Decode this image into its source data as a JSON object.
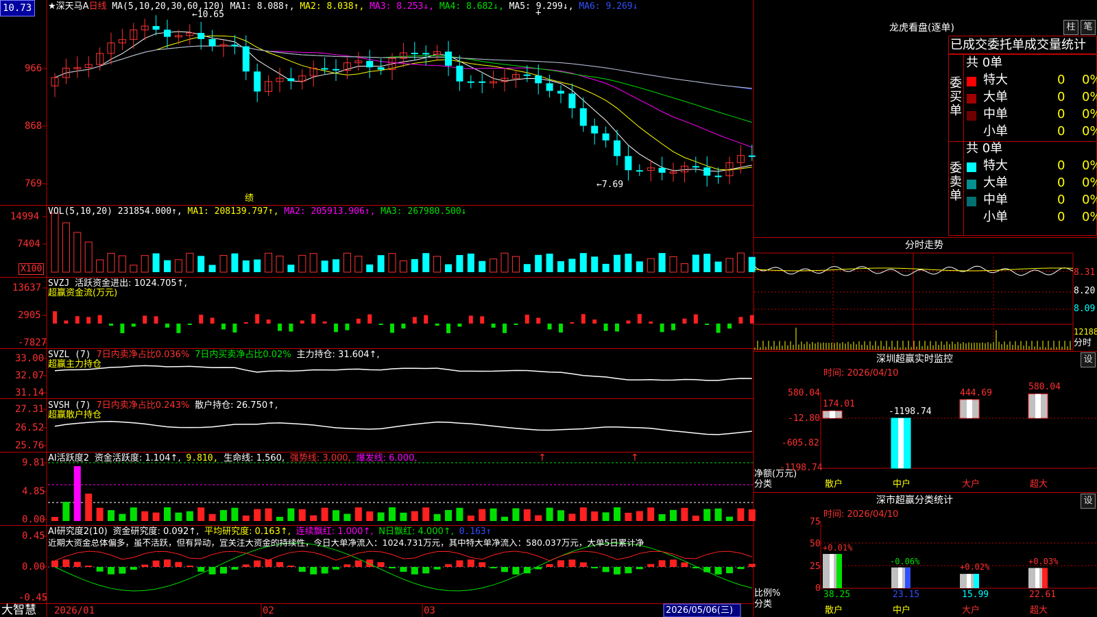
{
  "chart_title": "深天马A",
  "star": "★",
  "period": "日线",
  "price_tag": "10.73",
  "brand": "大智慧",
  "main": {
    "ma_header": "MA(5,10,20,30,60,120)",
    "ma1": "MA1: 8.088↑,",
    "ma2": "MA2: 8.038↑,",
    "ma3": "MA3: 8.253↓,",
    "ma4": "MA4: 8.682↓,",
    "ma5": "MA5: 9.299↓,",
    "ma6": "MA6: 9.269↓",
    "y_ticks": [
      "966",
      "868",
      "769"
    ],
    "high_note": "←10.65",
    "low_note": "←7.69",
    "earnings_marker": "绩",
    "plus_mark": "+"
  },
  "vol": {
    "header": "VOL(5,10,20)",
    "value": "231854.000↑,",
    "ma1": "MA1: 208139.797↑,",
    "ma2": "MA2: 205913.906↑,",
    "ma3": "MA3: 267980.500↓",
    "y_ticks": [
      "14994",
      "7404"
    ],
    "unit": "X100"
  },
  "svzj": {
    "name": "SVZJ",
    "label": "活跃资金进出: 1024.705↑,",
    "subtitle": "超赢资金流(万元)",
    "y_ticks": [
      "13637",
      "2905",
      "-7827"
    ]
  },
  "svzl": {
    "name": "SVZL (7)",
    "a": "7日内卖净占比0.036%",
    "b": "7日内买卖净占比0.02%",
    "c": "主力持仓: 31.604↑,",
    "subtitle": "超赢主力持仓",
    "y_ticks": [
      "33.00",
      "32.07",
      "31.14"
    ]
  },
  "svsh": {
    "name": "SVSH (7)",
    "a": "7日内卖净占比0.243%",
    "b": "散户持仓: 26.750↑,",
    "subtitle": "超赢散户持仓",
    "y_ticks": [
      "27.31",
      "26.52",
      "25.76"
    ]
  },
  "ai_active": {
    "name": "AI活跃度2",
    "a": "资金活跃度: 1.104↑,",
    "b": "9.810,",
    "c": "生命线: 1.560,",
    "d": "强势线: 3.000,",
    "e": "爆发线: 6.000,",
    "y_ticks": [
      "9.81",
      "4.85",
      "0.00"
    ]
  },
  "ai_research": {
    "name": "AI研究度2(10)",
    "a": "资金研究度: 0.092↑,",
    "b": "平均研究度: 0.163↑,",
    "c": "连续飘红: 1.000↑,",
    "d": "N日飘红: 4.000↑,",
    "e": "0.163↑",
    "comment": "近期大资金总体偏多，虽不活跃，但有异动，宜关注大资金的持续性，今日大单净流入：1024.731万元，其中特大单净流入：580.037万元，大单5日累计净",
    "y_ticks": [
      "0.45",
      "0.00",
      "-0.45"
    ]
  },
  "date_axis": {
    "labels": [
      "2026/01",
      "02",
      "03"
    ],
    "current": "2026/05/06(三)"
  },
  "dragon": {
    "title": "龙虎看盘(逐单)",
    "btn1": "柱",
    "btn2": "笔",
    "tabs": "已成交委托单成交量统计",
    "buy_label": "委买单",
    "sell_label": "委卖单",
    "buy_total": "共 0单",
    "sell_total": "共 0单",
    "buy_rows": [
      {
        "label": "特大",
        "count": "0",
        "pct": "0%"
      },
      {
        "label": "大单",
        "count": "0",
        "pct": "0%"
      },
      {
        "label": "中单",
        "count": "0",
        "pct": "0%"
      },
      {
        "label": "小单",
        "count": "0",
        "pct": "0%"
      }
    ],
    "sell_rows": [
      {
        "label": "特大",
        "count": "0",
        "pct": "0%"
      },
      {
        "label": "大单",
        "count": "0",
        "pct": "0%"
      },
      {
        "label": "中单",
        "count": "0",
        "pct": "0%"
      },
      {
        "label": "小单",
        "count": "0",
        "pct": "0%"
      }
    ]
  },
  "intraday": {
    "title": "分时走势",
    "p1": "8.31",
    "p2": "8.20",
    "p3": "8.09",
    "v1": "12188",
    "v2": "分时"
  },
  "sz_monitor": {
    "title": "深圳超赢实时监控",
    "btn": "设",
    "time": "时间: 2026/04/10",
    "y_ticks": [
      "580.04",
      "-12.80",
      "-605.82",
      "-1198.74"
    ],
    "ylabel1": "净额(万元)",
    "ylabel2": "分类",
    "cats": [
      "散户",
      "中户",
      "大户",
      "超大"
    ],
    "values": [
      "174.01",
      "-1198.74",
      "444.69",
      "580.04"
    ]
  },
  "sz_class": {
    "title": "深市超赢分类统计",
    "btn": "设",
    "time": "时间: 2026/04/10",
    "y_ticks": [
      "75",
      "50",
      "25",
      "0"
    ],
    "ylabel1": "比例%",
    "ylabel2": "分类",
    "cats": [
      "散户",
      "中户",
      "大户",
      "超大"
    ],
    "values": [
      "38.25",
      "23.15",
      "15.99",
      "22.61"
    ],
    "changes": [
      "+0.01%",
      "-0.06%",
      "+0.02%",
      "+0.03%"
    ]
  },
  "colors": {
    "up": "#ff3232",
    "down": "#00ffff",
    "ma1": "#ffffff",
    "ma2": "#ffff00",
    "ma3": "#ff00ff",
    "ma4": "#00e000",
    "ma5": "#3050ff",
    "ma6": "#c0c0c0",
    "grid": "#c00000"
  }
}
